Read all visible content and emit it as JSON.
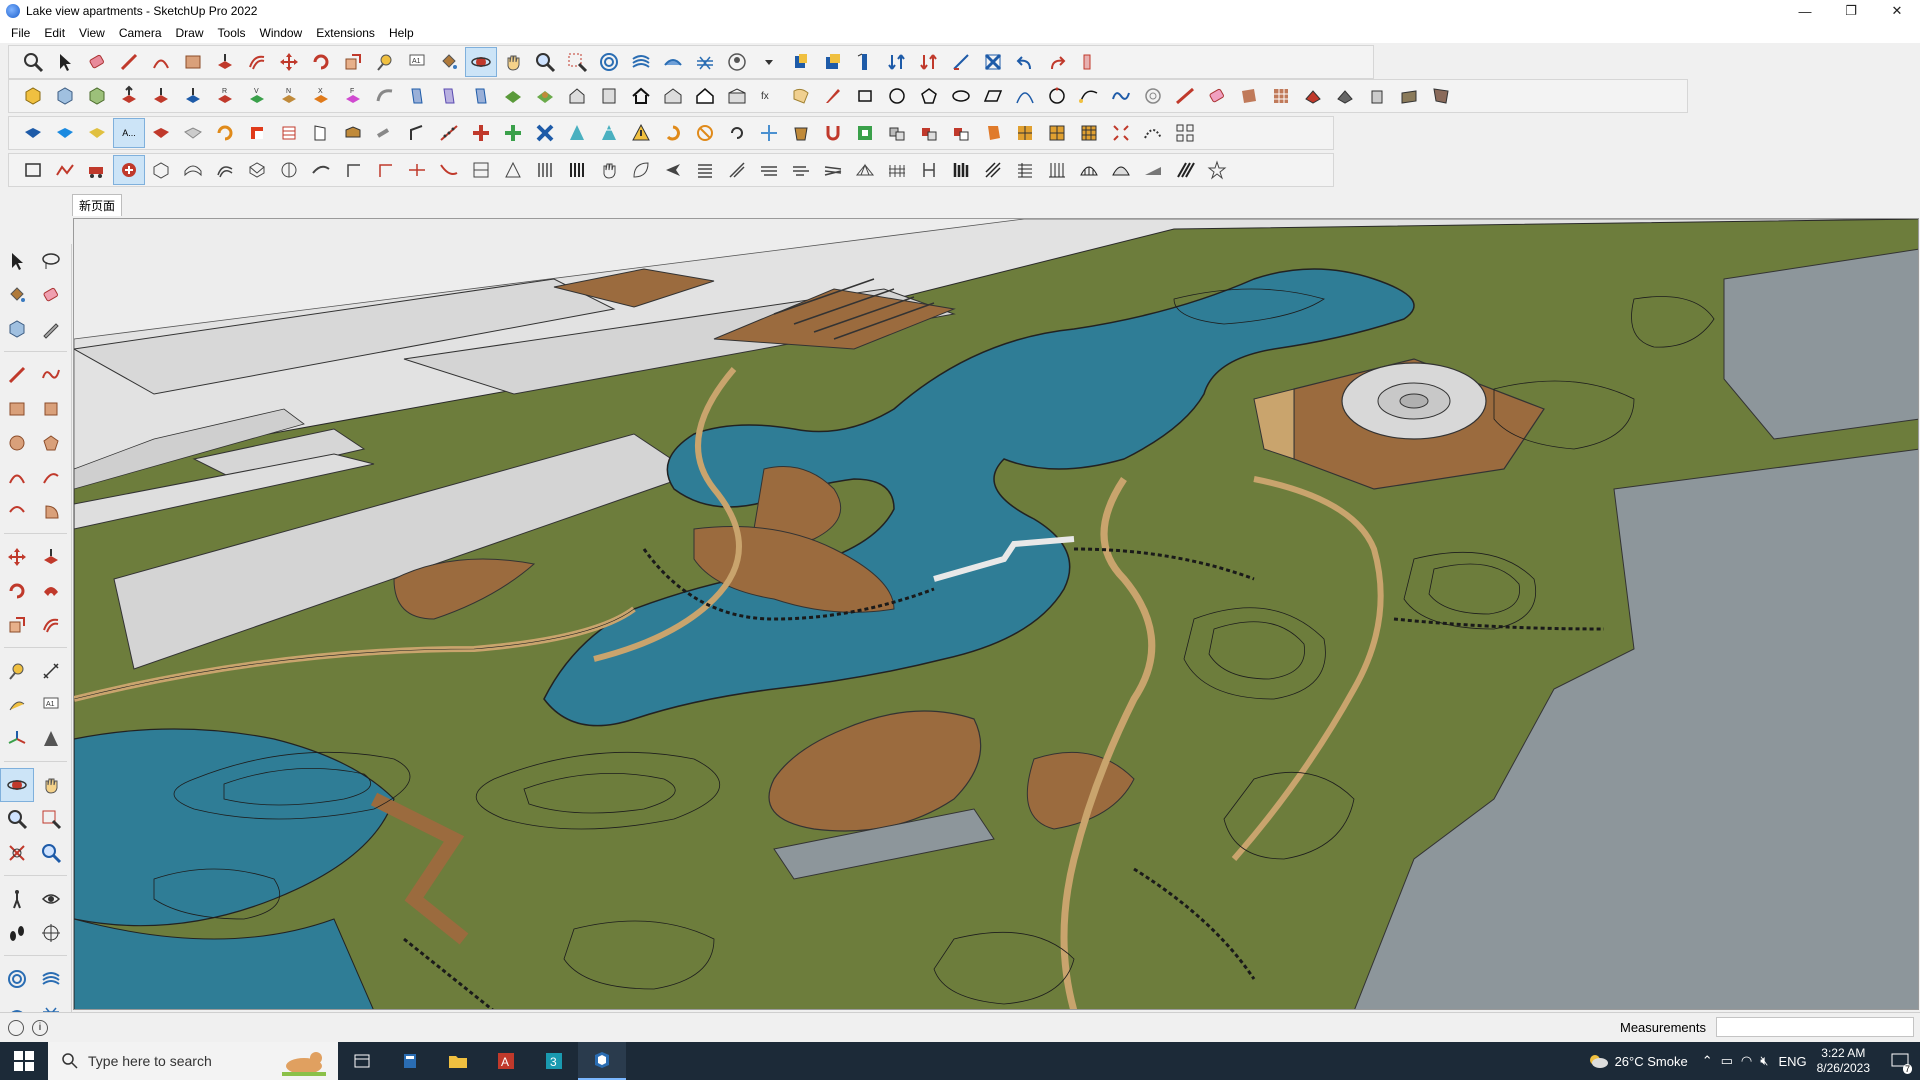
{
  "window": {
    "title": "Lake view apartments - SketchUp Pro 2022",
    "controls": [
      "—",
      "❐",
      "✕"
    ]
  },
  "menu": [
    "File",
    "Edit",
    "View",
    "Camera",
    "Draw",
    "Tools",
    "Window",
    "Extensions",
    "Help"
  ],
  "scene_tab": "新页面",
  "floating_tag": "A...",
  "status": {
    "measurements_label": "Measurements",
    "measurements_value": ""
  },
  "taskbar": {
    "search_placeholder": "Type here to search",
    "weather": "26°C  Smoke",
    "language": "ENG",
    "time": "3:22 AM",
    "date": "8/26/2023",
    "notification_count": "7"
  },
  "colors": {
    "water": "#2f7d96",
    "grass": "#6d7d3c",
    "path": "#c9a46d",
    "plaza": "#9b6b3e",
    "building": "#d4d4d4",
    "paving": "#8d969b"
  }
}
